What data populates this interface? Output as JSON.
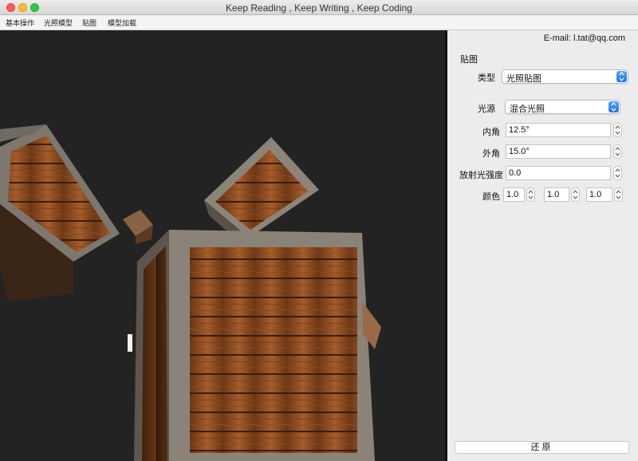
{
  "window": {
    "title": "Keep Reading , Keep Writing , Keep Coding"
  },
  "menu": {
    "items": [
      "基本操作",
      "光照模型",
      "贴图",
      "模型加载"
    ]
  },
  "scene": {
    "description_icon": "wooden-crate",
    "background_color": "#232323"
  },
  "panel": {
    "email": "E-mail: l.tat@qq.com",
    "section_title": "贴图",
    "type": {
      "label": "类型",
      "value": "光照贴图"
    },
    "light_source": {
      "label": "光源",
      "value": "混合光照"
    },
    "inner_angle": {
      "label": "内角",
      "value": "12.5°"
    },
    "outer_angle": {
      "label": "外角",
      "value": "15.0°"
    },
    "emission": {
      "label": "放射光强度",
      "value": "0.0"
    },
    "color": {
      "label": "颜色",
      "r": "1.0",
      "g": "1.0",
      "b": "1.0"
    },
    "reset_label": "还原",
    "accent_color": "#1a73ec"
  }
}
